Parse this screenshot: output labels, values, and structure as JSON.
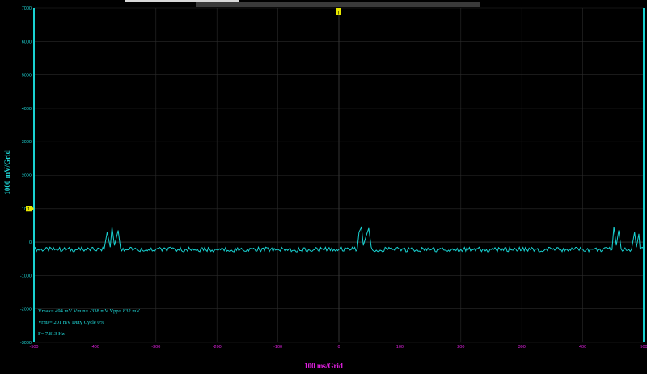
{
  "y_axis": {
    "label": "1000 mV/Grid",
    "ticks": [
      "7000",
      "6000",
      "5000",
      "4000",
      "3000",
      "2000",
      "1000",
      "0",
      "-1000",
      "-2000",
      "-3000"
    ],
    "min": -3000,
    "max": 7000
  },
  "x_axis": {
    "label": "100 ms/Grid",
    "ticks": [
      "-500",
      "-400",
      "-300",
      "-200",
      "-100",
      "0",
      "100",
      "200",
      "300",
      "400",
      "500"
    ],
    "min": -500,
    "max": 500
  },
  "markers": {
    "trigger_marker": "T",
    "channel_marker": "1",
    "channel_level_mv": 1000
  },
  "measurements": {
    "line1": "Vmax= 494 mV  Vmin= -338 mV  Vpp= 832 mV",
    "line2": "Vrms= 201 mV  Duty Cycle 0%",
    "line3": "F= 7.813 Hz"
  },
  "colors": {
    "trace": "#19d2d2",
    "grid": "#2b2b2b",
    "axis_text_y": "#1fd6d6",
    "axis_text_x": "#e020e0",
    "marker": "#e8e800"
  },
  "chart_data": {
    "type": "line",
    "xlabel": "100 ms/Grid",
    "ylabel": "1000 mV/Grid",
    "xlim": [
      -500,
      500
    ],
    "ylim": [
      -3000,
      7000
    ],
    "series": [
      {
        "values": [
          [
            -500,
            -200
          ],
          [
            -460,
            -230
          ],
          [
            -420,
            -210
          ],
          [
            -385,
            -220
          ],
          [
            -380,
            300
          ],
          [
            -375,
            -150
          ],
          [
            -372,
            450
          ],
          [
            -368,
            -100
          ],
          [
            -362,
            350
          ],
          [
            -358,
            -200
          ],
          [
            -330,
            -230
          ],
          [
            -300,
            -210
          ],
          [
            -250,
            -220
          ],
          [
            -200,
            -230
          ],
          [
            -150,
            -210
          ],
          [
            -100,
            -220
          ],
          [
            -50,
            -230
          ],
          [
            0,
            -210
          ],
          [
            30,
            -220
          ],
          [
            33,
            300
          ],
          [
            37,
            450
          ],
          [
            40,
            -100
          ],
          [
            45,
            200
          ],
          [
            49,
            420
          ],
          [
            53,
            -150
          ],
          [
            80,
            -220
          ],
          [
            150,
            -230
          ],
          [
            200,
            -210
          ],
          [
            250,
            -220
          ],
          [
            300,
            -230
          ],
          [
            350,
            -220
          ],
          [
            400,
            -210
          ],
          [
            448,
            -220
          ],
          [
            451,
            460
          ],
          [
            455,
            -100
          ],
          [
            459,
            350
          ],
          [
            463,
            -200
          ],
          [
            480,
            -220
          ],
          [
            485,
            300
          ],
          [
            488,
            -150
          ],
          [
            492,
            250
          ],
          [
            500,
            -210
          ]
        ]
      }
    ]
  }
}
